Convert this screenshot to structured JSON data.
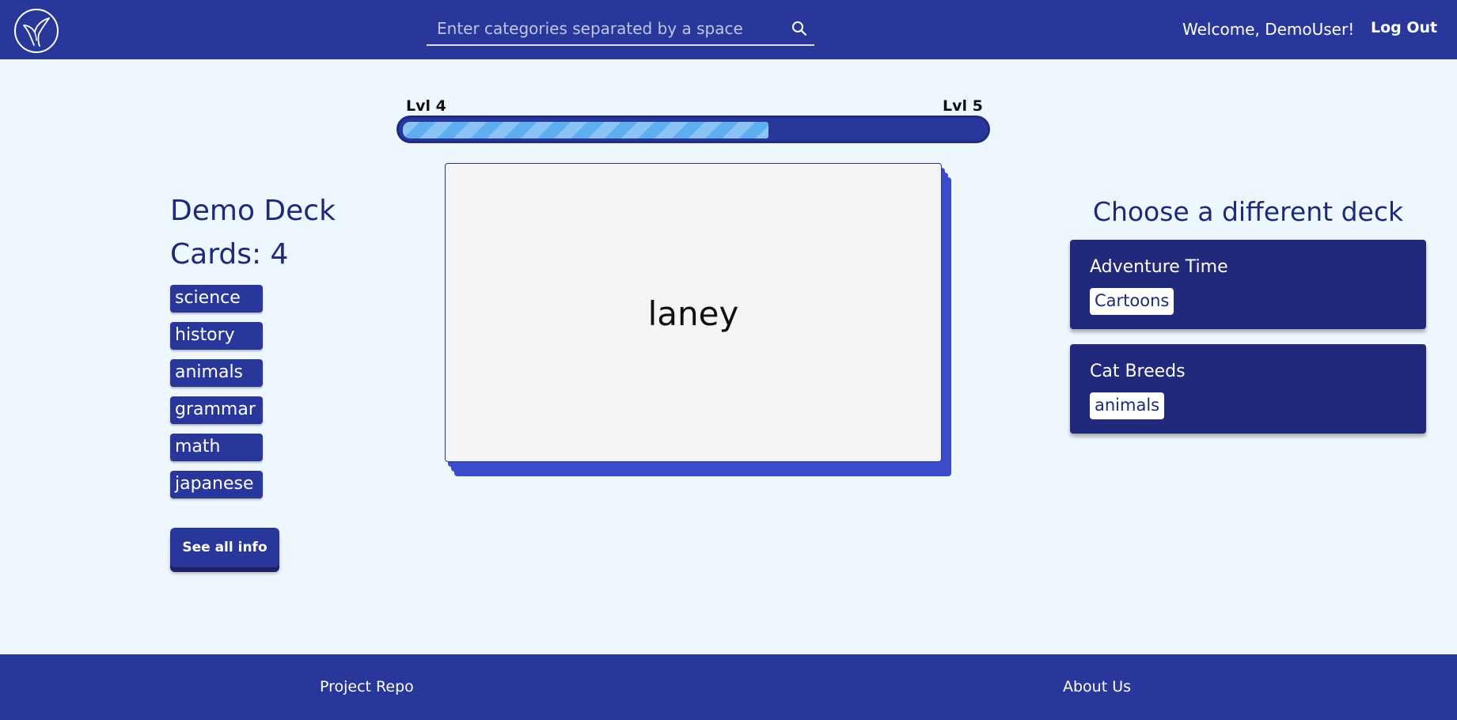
{
  "header": {
    "logo": "whale-tail-logo-icon",
    "search_placeholder": "Enter categories separated by a space",
    "search_value": "",
    "search_icon": "search-icon",
    "welcome_text": "Welcome, DemoUser!",
    "logout_label": "Log Out"
  },
  "progress": {
    "current_level_label": "Lvl 4",
    "next_level_label": "Lvl 5",
    "fraction": 0.63
  },
  "deck": {
    "title": "Demo Deck",
    "card_count_text": "Cards: 4",
    "categories": [
      "science",
      "history",
      "animals",
      "grammar",
      "math",
      "japanese"
    ],
    "see_all_label": "See all info"
  },
  "flashcard": {
    "text": "laney"
  },
  "other_decks": {
    "title": "Choose a different deck",
    "decks": [
      {
        "title": "Adventure Time",
        "tag": "Cartoons"
      },
      {
        "title": "Cat Breeds",
        "tag": "animals"
      }
    ]
  },
  "footer": {
    "project_repo_label": "Project Repo",
    "about_label": "About Us"
  },
  "colors": {
    "nav_bg": "#283799",
    "page_bg": "#eff7fe",
    "deck_card_bg": "#21297b",
    "progress_fill": "#5eaef0",
    "card_stack": "#3b4cc9"
  }
}
